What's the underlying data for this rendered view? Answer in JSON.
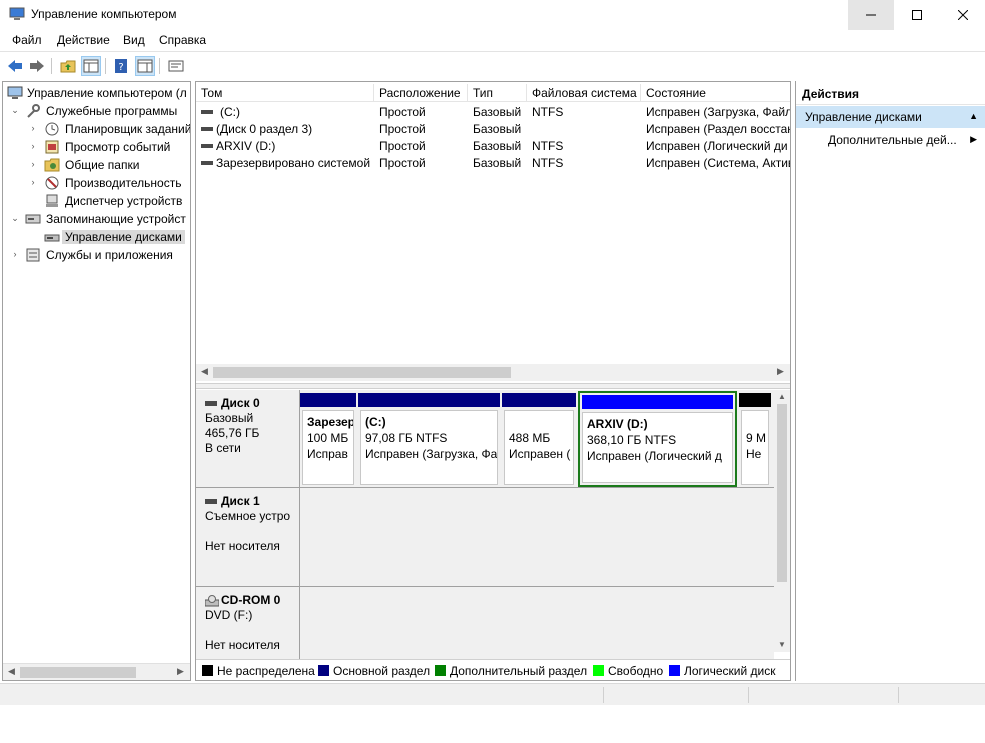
{
  "window": {
    "title": "Управление компьютером"
  },
  "menu": [
    "Файл",
    "Действие",
    "Вид",
    "Справка"
  ],
  "tree": [
    {
      "label": "Управление компьютером (л",
      "icon": "computer-management-icon",
      "level": 0,
      "arrow": ""
    },
    {
      "label": "Служебные программы",
      "icon": "tools-icon",
      "level": 1,
      "arrow": "down"
    },
    {
      "label": "Планировщик заданий",
      "icon": "clock-icon",
      "level": 2,
      "arrow": "right"
    },
    {
      "label": "Просмотр событий",
      "icon": "event-viewer-icon",
      "level": 2,
      "arrow": "right"
    },
    {
      "label": "Общие папки",
      "icon": "shared-folder-icon",
      "level": 2,
      "arrow": "right"
    },
    {
      "label": "Производительность",
      "icon": "performance-icon",
      "level": 2,
      "arrow": "right"
    },
    {
      "label": "Диспетчер устройств",
      "icon": "device-manager-icon",
      "level": 2,
      "arrow": ""
    },
    {
      "label": "Запоминающие устройст",
      "icon": "storage-icon",
      "level": 1,
      "arrow": "down"
    },
    {
      "label": "Управление дисками",
      "icon": "disk-management-icon",
      "level": 2,
      "arrow": "",
      "selected": true
    },
    {
      "label": "Службы и приложения",
      "icon": "services-icon",
      "level": 1,
      "arrow": "right"
    }
  ],
  "volume_list": {
    "columns": [
      "Том",
      "Расположение",
      "Тип",
      "Файловая система",
      "Состояние"
    ],
    "rows": [
      [
        "(C:)",
        "Простой",
        "Базовый",
        "NTFS",
        "Исправен (Загрузка, Файл"
      ],
      [
        "(Диск 0 раздел 3)",
        "Простой",
        "Базовый",
        "",
        "Исправен (Раздел восстан"
      ],
      [
        "ARXIV (D:)",
        "Простой",
        "Базовый",
        "NTFS",
        "Исправен (Логический ди"
      ],
      [
        "Зарезервировано системой",
        "Простой",
        "Базовый",
        "NTFS",
        "Исправен (Система, Актив"
      ]
    ]
  },
  "disks": [
    {
      "name": "Диск 0",
      "type": "Базовый",
      "size": "465,76 ГБ",
      "status": "В сети",
      "partitions": [
        {
          "name": "Зарезерв",
          "size": "100 МБ",
          "status": "Исправ",
          "bar": "#000080"
        },
        {
          "name": "(C:)",
          "size": "97,08 ГБ NTFS",
          "status": "Исправен (Загрузка, Фа",
          "bar": "#000080"
        },
        {
          "name": "",
          "size": "488 МБ",
          "status": "Исправен (",
          "bar": "#000080"
        },
        {
          "name": "ARXIV  (D:)",
          "size": "368,10 ГБ NTFS",
          "status": "Исправен (Логический д",
          "bar": "#0000ff",
          "selected": true
        },
        {
          "name": "",
          "size": "9 М",
          "status": "Не",
          "bar": "#000000"
        }
      ]
    },
    {
      "name": "Диск 1",
      "type": "Съемное устро",
      "size": "",
      "status": "Нет носителя"
    },
    {
      "name": "CD-ROM 0",
      "type": "DVD (F:)",
      "size": "",
      "status": "Нет носителя"
    }
  ],
  "legend": [
    {
      "label": "Не распределена",
      "color": "#000000"
    },
    {
      "label": "Основной раздел",
      "color": "#000080"
    },
    {
      "label": "Дополнительный раздел",
      "color": "#008000"
    },
    {
      "label": "Свободно",
      "color": "#00ff00"
    },
    {
      "label": "Логический диск",
      "color": "#0000ff"
    }
  ],
  "actions": {
    "header": "Действия",
    "section": "Управление дисками",
    "item": "Дополнительные дей..."
  }
}
